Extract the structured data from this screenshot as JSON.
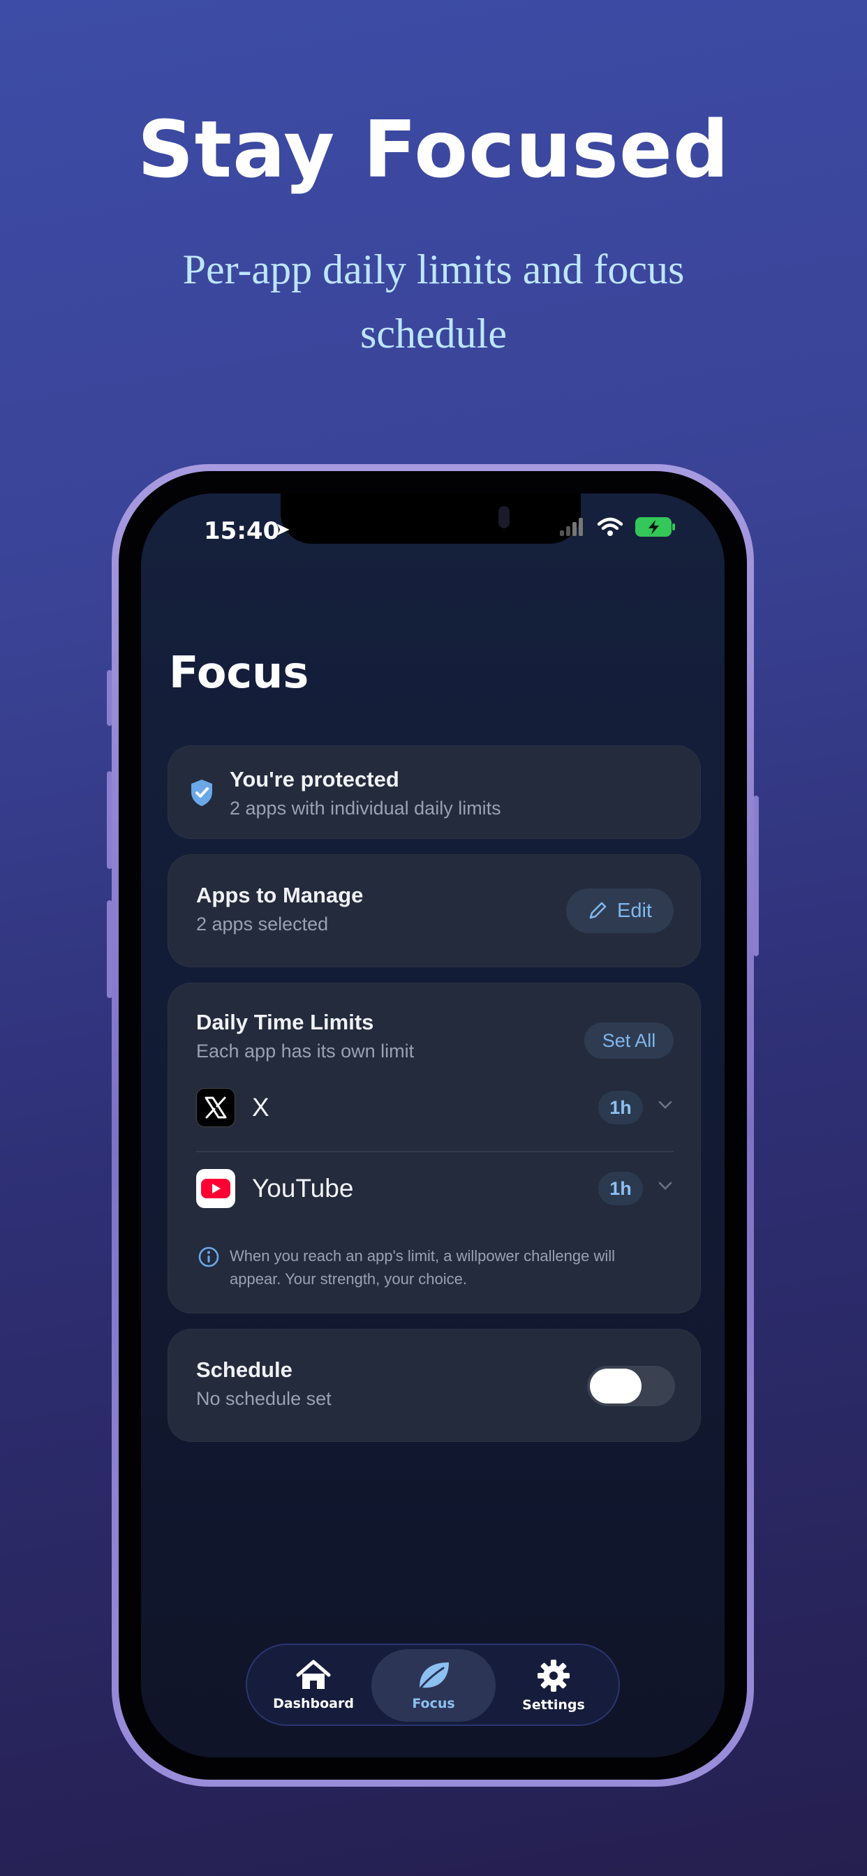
{
  "headline": "Stay Focused",
  "subheadline": "Per-app daily limits and focus schedule",
  "status_bar": {
    "time": "15:40"
  },
  "screen": {
    "title": "Focus",
    "protection": {
      "title": "You're protected",
      "subtitle": "2 apps with individual daily limits"
    },
    "apps_to_manage": {
      "title": "Apps to Manage",
      "subtitle": "2 apps selected",
      "edit_label": "Edit"
    },
    "daily_limits": {
      "title": "Daily Time Limits",
      "subtitle": "Each app has its own limit",
      "set_all_label": "Set All",
      "apps": [
        {
          "name": "X",
          "limit": "1h",
          "icon": "x-logo-icon"
        },
        {
          "name": "YouTube",
          "limit": "1h",
          "icon": "youtube-logo-icon"
        }
      ],
      "info": "When you reach an app's limit, a willpower challenge will appear. Your strength, your choice."
    },
    "schedule": {
      "title": "Schedule",
      "subtitle": "No schedule set",
      "enabled": false
    }
  },
  "tab_bar": {
    "active": "Focus",
    "tabs": [
      {
        "label": "Dashboard",
        "icon": "house-icon"
      },
      {
        "label": "Focus",
        "icon": "leaf-icon"
      },
      {
        "label": "Settings",
        "icon": "gear-icon"
      }
    ]
  },
  "colors": {
    "accent": "#7fb8f0",
    "card": "#232b3c",
    "subtitle": "#bde6ff"
  }
}
